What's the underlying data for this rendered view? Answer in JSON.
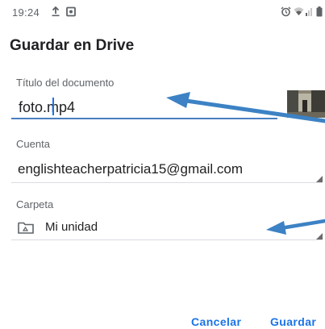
{
  "status_bar": {
    "time": "19:24",
    "left_icons": [
      "upload-icon",
      "screen-record-icon"
    ],
    "right_icons": [
      "alarm-icon",
      "wifi-icon",
      "signal-icon",
      "battery-icon"
    ]
  },
  "dialog": {
    "title": "Guardar en Drive",
    "document_title": {
      "label": "Título del documento",
      "value": "foto.mp4"
    },
    "account": {
      "label": "Cuenta",
      "value": "englishteacherpatricia15@gmail.com"
    },
    "folder": {
      "label": "Carpeta",
      "icon": "drive-folder-icon",
      "value": "Mi unidad"
    },
    "buttons": {
      "cancel": "Cancelar",
      "save": "Guardar"
    }
  },
  "annotations": {
    "arrow_color": "#3c82c4"
  },
  "colors": {
    "accent": "#1a73e8",
    "underline": "#4a7fc1",
    "text": "#202124",
    "label": "#5f6368"
  }
}
